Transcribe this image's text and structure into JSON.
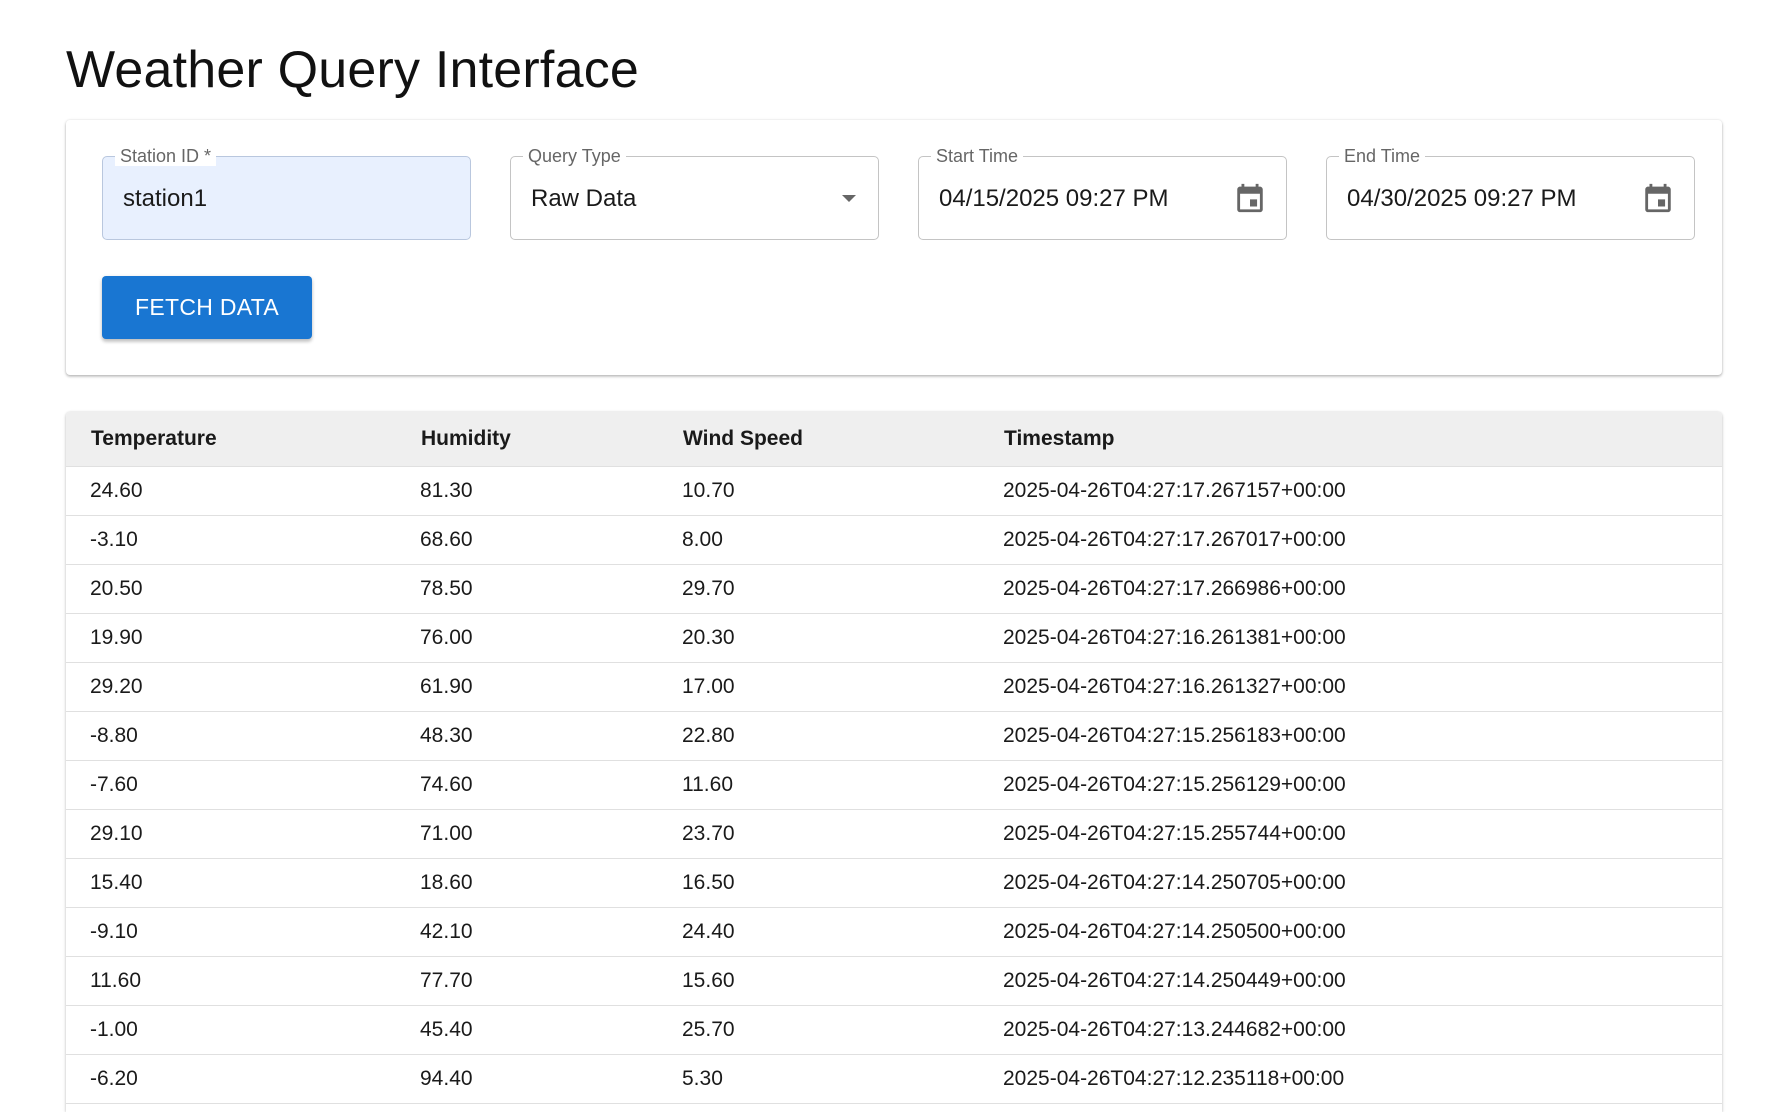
{
  "page": {
    "title": "Weather Query Interface"
  },
  "form": {
    "station_id": {
      "label": "Station ID *",
      "value": "station1"
    },
    "query_type": {
      "label": "Query Type",
      "value": "Raw Data"
    },
    "start_time": {
      "label": "Start Time",
      "value": "04/15/2025 09:27 PM"
    },
    "end_time": {
      "label": "End Time",
      "value": "04/30/2025 09:27 PM"
    },
    "fetch_label": "Fetch Data"
  },
  "table": {
    "headers": [
      "Temperature",
      "Humidity",
      "Wind Speed",
      "Timestamp"
    ],
    "rows": [
      [
        "24.60",
        "81.30",
        "10.70",
        "2025-04-26T04:27:17.267157+00:00"
      ],
      [
        "-3.10",
        "68.60",
        "8.00",
        "2025-04-26T04:27:17.267017+00:00"
      ],
      [
        "20.50",
        "78.50",
        "29.70",
        "2025-04-26T04:27:17.266986+00:00"
      ],
      [
        "19.90",
        "76.00",
        "20.30",
        "2025-04-26T04:27:16.261381+00:00"
      ],
      [
        "29.20",
        "61.90",
        "17.00",
        "2025-04-26T04:27:16.261327+00:00"
      ],
      [
        "-8.80",
        "48.30",
        "22.80",
        "2025-04-26T04:27:15.256183+00:00"
      ],
      [
        "-7.60",
        "74.60",
        "11.60",
        "2025-04-26T04:27:15.256129+00:00"
      ],
      [
        "29.10",
        "71.00",
        "23.70",
        "2025-04-26T04:27:15.255744+00:00"
      ],
      [
        "15.40",
        "18.60",
        "16.50",
        "2025-04-26T04:27:14.250705+00:00"
      ],
      [
        "-9.10",
        "42.10",
        "24.40",
        "2025-04-26T04:27:14.250500+00:00"
      ],
      [
        "11.60",
        "77.70",
        "15.60",
        "2025-04-26T04:27:14.250449+00:00"
      ],
      [
        "-1.00",
        "45.40",
        "25.70",
        "2025-04-26T04:27:13.244682+00:00"
      ],
      [
        "-6.20",
        "94.40",
        "5.30",
        "2025-04-26T04:27:12.235118+00:00"
      ]
    ]
  },
  "icons": {
    "calendar": "calendar-icon",
    "dropdown": "arrow-drop-down-icon"
  },
  "colors": {
    "primary": "#1976d2",
    "autofill": "#e8f0fe",
    "header_bg": "#efefef"
  }
}
